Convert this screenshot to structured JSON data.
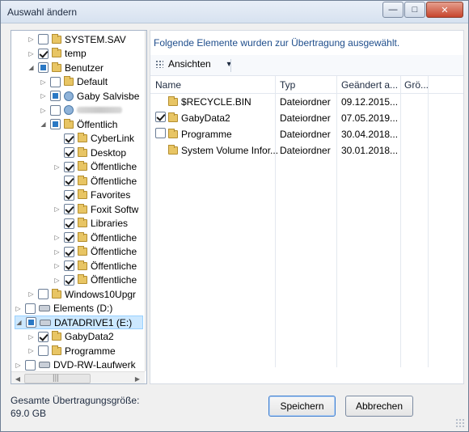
{
  "window": {
    "title": "Auswahl ändern",
    "controls": {
      "minimize": "—",
      "maximize": "□",
      "close": "✕"
    }
  },
  "tree": {
    "items": [
      {
        "label": "SYSTEM.SAV",
        "level": 2,
        "expander": "▷",
        "checkbox": "unchecked",
        "icon": "folder-icon"
      },
      {
        "label": "temp",
        "level": 2,
        "expander": "▷",
        "checkbox": "checked",
        "icon": "folder-icon"
      },
      {
        "label": "Benutzer",
        "level": 2,
        "expander": "◢",
        "checkbox": "partial",
        "icon": "folder-icon"
      },
      {
        "label": "Default",
        "level": 3,
        "expander": "▷",
        "checkbox": "unchecked",
        "icon": "folder-icon"
      },
      {
        "label": "Gaby Salvisbe",
        "level": 3,
        "expander": "▷",
        "checkbox": "partial",
        "icon": "user-folder-icon"
      },
      {
        "label": "",
        "level": 3,
        "expander": "▷",
        "checkbox": "unchecked",
        "icon": "user-folder-icon"
      },
      {
        "label": "Öffentlich",
        "level": 3,
        "expander": "◢",
        "checkbox": "partial",
        "icon": "folder-icon"
      },
      {
        "label": "CyberLink",
        "level": 4,
        "expander": "",
        "checkbox": "checked",
        "icon": "folder-icon"
      },
      {
        "label": "Desktop",
        "level": 4,
        "expander": "",
        "checkbox": "checked",
        "icon": "folder-icon"
      },
      {
        "label": "Öffentliche",
        "level": 4,
        "expander": "▷",
        "checkbox": "checked",
        "icon": "folder-icon"
      },
      {
        "label": "Öffentliche",
        "level": 4,
        "expander": "",
        "checkbox": "checked",
        "icon": "folder-icon"
      },
      {
        "label": "Favorites",
        "level": 4,
        "expander": "",
        "checkbox": "checked",
        "icon": "folder-icon"
      },
      {
        "label": "Foxit Softw",
        "level": 4,
        "expander": "▷",
        "checkbox": "checked",
        "icon": "folder-icon"
      },
      {
        "label": "Libraries",
        "level": 4,
        "expander": "",
        "checkbox": "checked",
        "icon": "folder-icon"
      },
      {
        "label": "Öffentliche",
        "level": 4,
        "expander": "▷",
        "checkbox": "checked",
        "icon": "folder-icon"
      },
      {
        "label": "Öffentliche",
        "level": 4,
        "expander": "▷",
        "checkbox": "checked",
        "icon": "folder-icon"
      },
      {
        "label": "Öffentliche",
        "level": 4,
        "expander": "▷",
        "checkbox": "checked",
        "icon": "folder-icon"
      },
      {
        "label": "Öffentliche",
        "level": 4,
        "expander": "▷",
        "checkbox": "checked",
        "icon": "folder-icon"
      },
      {
        "label": "Windows10Upgr",
        "level": 2,
        "expander": "▷",
        "checkbox": "unchecked",
        "icon": "folder-icon"
      },
      {
        "label": "Elements (D:)",
        "level": 1,
        "expander": "▷",
        "checkbox": "unchecked",
        "icon": "drive-icon"
      },
      {
        "label": "DATADRIVE1 (E:)",
        "level": 1,
        "expander": "◢",
        "checkbox": "partial",
        "icon": "drive-icon",
        "selected": true
      },
      {
        "label": "GabyData2",
        "level": 2,
        "expander": "▷",
        "checkbox": "checked",
        "icon": "folder-icon"
      },
      {
        "label": "Programme",
        "level": 2,
        "expander": "▷",
        "checkbox": "unchecked",
        "icon": "folder-icon"
      },
      {
        "label": "DVD-RW-Laufwerk",
        "level": 1,
        "expander": "▷",
        "checkbox": "unchecked",
        "icon": "dvd-drive-icon"
      }
    ],
    "scroll": {
      "up": "▲",
      "down": "▼",
      "left": "◀",
      "right": "▶",
      "v_grip": "≡",
      "h_grip": "|||"
    }
  },
  "right_pane": {
    "info_text": "Folgende Elemente wurden zur Übertragung ausgewählt.",
    "toolbar": {
      "views_label": "Ansichten",
      "dropdown_arrow": "▼"
    },
    "columns": [
      "Name",
      "Typ",
      "Geändert a...",
      "Grö..."
    ],
    "rows": [
      {
        "checked": null,
        "name": "$RECYCLE.BIN",
        "type": "Dateiordner",
        "date": "09.12.2015...",
        "size": ""
      },
      {
        "checked": true,
        "name": "GabyData2",
        "type": "Dateiordner",
        "date": "07.05.2019...",
        "size": ""
      },
      {
        "checked": false,
        "name": "Programme",
        "type": "Dateiordner",
        "date": "30.04.2018...",
        "size": ""
      },
      {
        "checked": null,
        "name": "System Volume Infor...",
        "type": "Dateiordner",
        "date": "30.01.2018...",
        "size": ""
      }
    ]
  },
  "footer": {
    "total_label": "Gesamte Übertragungsgröße:",
    "total_value": "69.0 GB",
    "save_label": "Speichern",
    "cancel_label": "Abbrechen"
  }
}
